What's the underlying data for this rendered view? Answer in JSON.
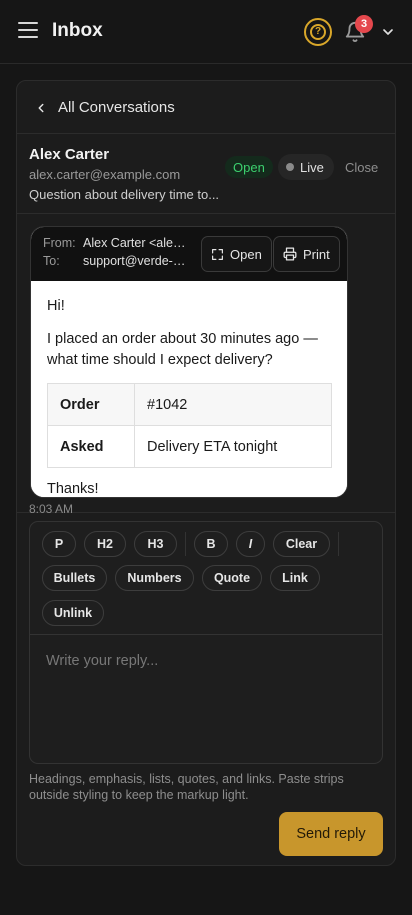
{
  "header": {
    "title": "Inbox",
    "notification_count": "3",
    "accent_color": "#d9a72a"
  },
  "nav": {
    "back_label": "All Conversations"
  },
  "conversation": {
    "name": "Alex Carter",
    "email": "alex.carter@example.com",
    "subject": "Question about delivery time to...",
    "status": "Open",
    "live_label": "Live",
    "close_label": "Close"
  },
  "message": {
    "from_label": "From:",
    "from_value": "Alex Carter <alex.carter@example.com>",
    "to_label": "To:",
    "to_value": "support@verde-rutas.example",
    "open_label": "Open",
    "print_label": "Print",
    "greeting": "Hi!",
    "body": "I placed an order about 30 minutes ago — what time should I expect delivery?",
    "table": [
      {
        "key": "Order",
        "value": "#1042"
      },
      {
        "key": "Asked",
        "value": "Delivery ETA tonight"
      }
    ],
    "closing": "Thanks!",
    "time": "8:03 AM"
  },
  "editor": {
    "toolbar": [
      "P",
      "H2",
      "H3",
      "B",
      "I",
      "Clear",
      "Bullets",
      "Numbers",
      "Quote",
      "Link",
      "Unlink"
    ],
    "placeholder": "Write your reply...",
    "hint": "Headings, emphasis, lists, quotes, and links. Paste strips outside styling to keep the markup light.",
    "send_label": "Send reply"
  }
}
